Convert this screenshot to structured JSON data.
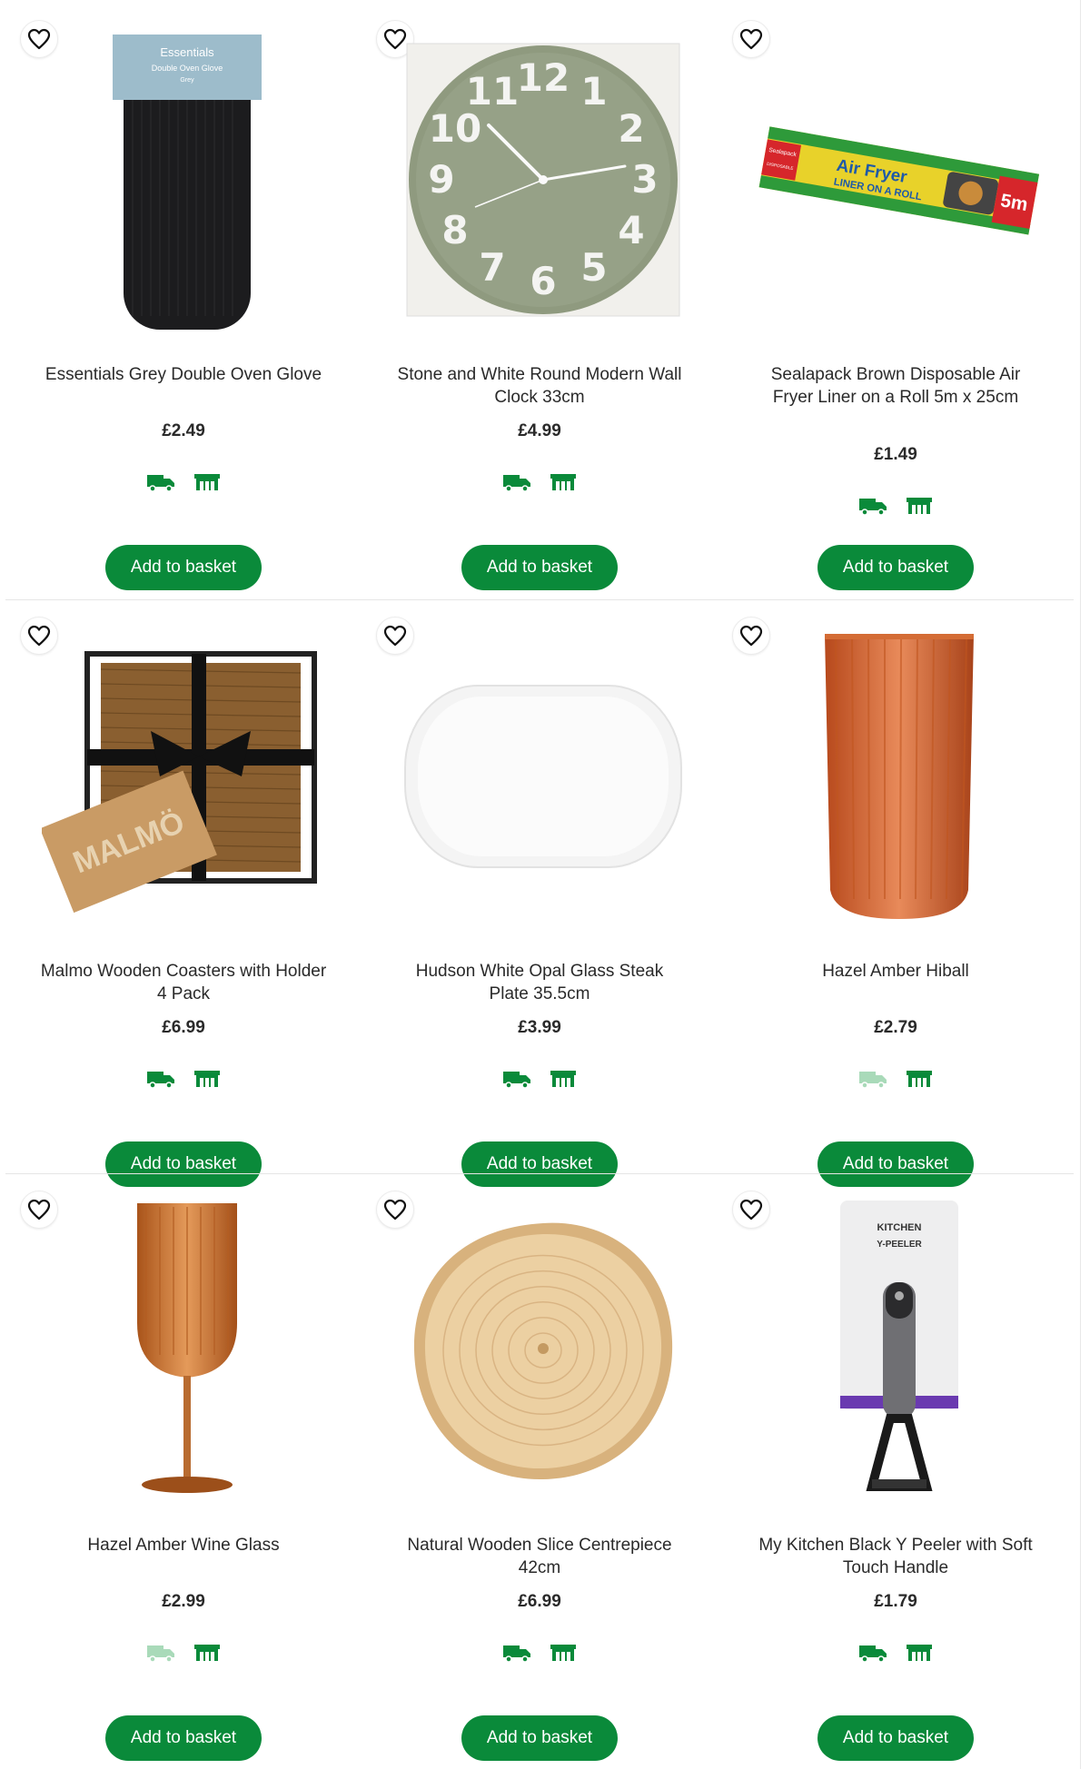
{
  "colors": {
    "accent": "#0a8a3a",
    "delivery_available": "#0a8a3a",
    "delivery_unavailable": "#a9dab9"
  },
  "products": [
    {
      "title": "Essentials Grey Double Oven Glove",
      "price": "£2.49",
      "button": "Add to basket",
      "delivery_available": true,
      "image": "oven-glove"
    },
    {
      "title": "Stone and White Round Modern Wall Clock 33cm",
      "price": "£4.99",
      "button": "Add to basket",
      "delivery_available": true,
      "image": "wall-clock"
    },
    {
      "title": "Sealapack Brown Disposable Air Fryer Liner on a Roll 5m x 25cm",
      "price": "£1.49",
      "button": "Add to basket",
      "delivery_available": true,
      "image": "air-fryer-liner"
    },
    {
      "title": "Malmo Wooden Coasters with Holder 4 Pack",
      "price": "£6.99",
      "button": "Add to basket",
      "delivery_available": true,
      "image": "coasters"
    },
    {
      "title": "Hudson White Opal Glass Steak Plate 35.5cm",
      "price": "£3.99",
      "button": "Add to basket",
      "delivery_available": true,
      "image": "steak-plate"
    },
    {
      "title": "Hazel Amber Hiball",
      "price": "£2.79",
      "button": "Add to basket",
      "delivery_available": false,
      "image": "hiball-glass"
    },
    {
      "title": "Hazel Amber Wine Glass",
      "price": "£2.99",
      "button": "Add to basket",
      "delivery_available": false,
      "image": "wine-glass"
    },
    {
      "title": "Natural Wooden Slice Centrepiece 42cm",
      "price": "£6.99",
      "button": "Add to basket",
      "delivery_available": true,
      "image": "wooden-slice"
    },
    {
      "title": "My Kitchen Black Y Peeler with Soft Touch Handle",
      "price": "£1.79",
      "button": "Add to basket",
      "delivery_available": true,
      "image": "y-peeler"
    }
  ],
  "images": {
    "oven_glove": {
      "brand": "Essentials",
      "line1": "Double Oven Glove",
      "line2": "Grey"
    },
    "clock_numerals": [
      "12",
      "1",
      "2",
      "3",
      "4",
      "5",
      "6",
      "7",
      "8",
      "9",
      "10",
      "11"
    ],
    "liner": {
      "brand": "Sealapack",
      "name1": "Air Fryer",
      "name2": "LINER ON A ROLL",
      "size": "5m",
      "tag": "DISPOSABLE"
    },
    "coasters": {
      "brand": "MALMÖ"
    },
    "peeler": {
      "brand": "KITCHEN",
      "name": "Y-PEELER"
    }
  }
}
